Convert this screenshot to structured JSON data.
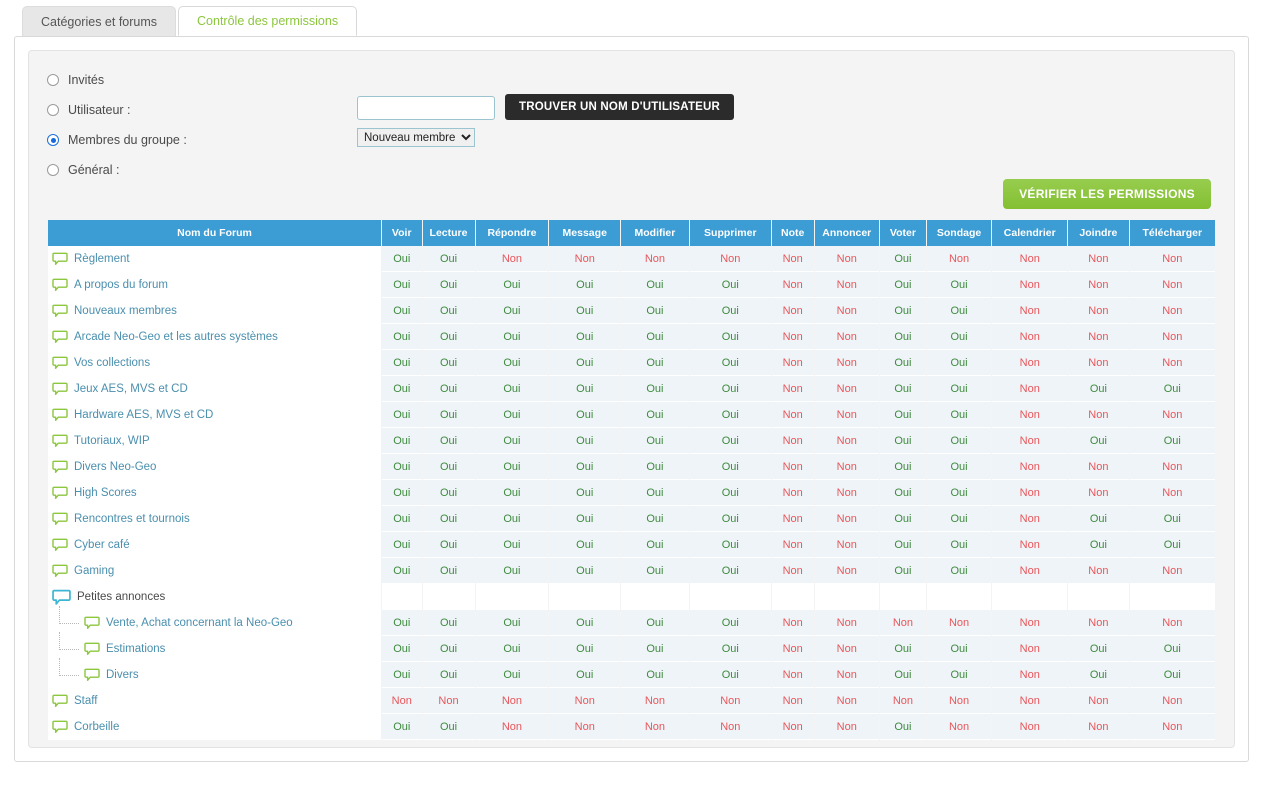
{
  "tabs": [
    {
      "label": "Catégories et forums",
      "active": false
    },
    {
      "label": "Contrôle des permissions",
      "active": true
    }
  ],
  "form": {
    "options": [
      {
        "label": "Invités",
        "checked": false
      },
      {
        "label": "Utilisateur :",
        "checked": false
      },
      {
        "label": "Membres du groupe :",
        "checked": true
      },
      {
        "label": "Général :",
        "checked": false
      }
    ],
    "username_value": "",
    "username_placeholder": "",
    "find_user_button": "TROUVER UN NOM D'UTILISATEUR",
    "group_selected": "Nouveau membre",
    "group_options": [
      "Nouveau membre"
    ],
    "verify_button": "VÉRIFIER LES PERMISSIONS"
  },
  "colors": {
    "header_blue": "#3c9cd4",
    "accent_green": "#8dc63f",
    "yes": "#3f8a3f",
    "no": "#e8565b",
    "link": "#4a8fae"
  },
  "table": {
    "columns": [
      "Nom du Forum",
      "Voir",
      "Lecture",
      "Répondre",
      "Message",
      "Modifier",
      "Supprimer",
      "Note",
      "Annoncer",
      "Voter",
      "Sondage",
      "Calendrier",
      "Joindre",
      "Télécharger"
    ],
    "rows": [
      {
        "name": "Règlement",
        "icon": "forum-bubble-icon",
        "type": "forum",
        "indent": 0,
        "values": [
          "Oui",
          "Oui",
          "Non",
          "Non",
          "Non",
          "Non",
          "Non",
          "Non",
          "Oui",
          "Non",
          "Non",
          "Non",
          "Non"
        ]
      },
      {
        "name": "A propos du forum",
        "icon": "forum-bubble-icon",
        "type": "forum",
        "indent": 0,
        "values": [
          "Oui",
          "Oui",
          "Oui",
          "Oui",
          "Oui",
          "Oui",
          "Non",
          "Non",
          "Oui",
          "Oui",
          "Non",
          "Non",
          "Non"
        ]
      },
      {
        "name": "Nouveaux membres",
        "icon": "forum-bubble-icon",
        "type": "forum",
        "indent": 0,
        "values": [
          "Oui",
          "Oui",
          "Oui",
          "Oui",
          "Oui",
          "Oui",
          "Non",
          "Non",
          "Oui",
          "Oui",
          "Non",
          "Non",
          "Non"
        ]
      },
      {
        "name": "Arcade Neo-Geo et les autres systèmes",
        "icon": "forum-bubble-icon",
        "type": "forum",
        "indent": 0,
        "values": [
          "Oui",
          "Oui",
          "Oui",
          "Oui",
          "Oui",
          "Oui",
          "Non",
          "Non",
          "Oui",
          "Oui",
          "Non",
          "Non",
          "Non"
        ]
      },
      {
        "name": "Vos collections",
        "icon": "forum-bubble-icon",
        "type": "forum",
        "indent": 0,
        "values": [
          "Oui",
          "Oui",
          "Oui",
          "Oui",
          "Oui",
          "Oui",
          "Non",
          "Non",
          "Oui",
          "Oui",
          "Non",
          "Non",
          "Non"
        ]
      },
      {
        "name": "Jeux AES, MVS et CD",
        "icon": "forum-bubble-icon",
        "type": "forum",
        "indent": 0,
        "values": [
          "Oui",
          "Oui",
          "Oui",
          "Oui",
          "Oui",
          "Oui",
          "Non",
          "Non",
          "Oui",
          "Oui",
          "Non",
          "Oui",
          "Oui"
        ]
      },
      {
        "name": "Hardware AES, MVS et CD",
        "icon": "forum-bubble-icon",
        "type": "forum",
        "indent": 0,
        "values": [
          "Oui",
          "Oui",
          "Oui",
          "Oui",
          "Oui",
          "Oui",
          "Non",
          "Non",
          "Oui",
          "Oui",
          "Non",
          "Non",
          "Non"
        ]
      },
      {
        "name": "Tutoriaux, WIP",
        "icon": "forum-bubble-icon",
        "type": "forum",
        "indent": 0,
        "values": [
          "Oui",
          "Oui",
          "Oui",
          "Oui",
          "Oui",
          "Oui",
          "Non",
          "Non",
          "Oui",
          "Oui",
          "Non",
          "Oui",
          "Oui"
        ]
      },
      {
        "name": "Divers Neo-Geo",
        "icon": "forum-bubble-icon",
        "type": "forum",
        "indent": 0,
        "values": [
          "Oui",
          "Oui",
          "Oui",
          "Oui",
          "Oui",
          "Oui",
          "Non",
          "Non",
          "Oui",
          "Oui",
          "Non",
          "Non",
          "Non"
        ]
      },
      {
        "name": "High Scores",
        "icon": "forum-bubble-icon",
        "type": "forum",
        "indent": 0,
        "values": [
          "Oui",
          "Oui",
          "Oui",
          "Oui",
          "Oui",
          "Oui",
          "Non",
          "Non",
          "Oui",
          "Oui",
          "Non",
          "Non",
          "Non"
        ]
      },
      {
        "name": "Rencontres et tournois",
        "icon": "forum-bubble-icon",
        "type": "forum",
        "indent": 0,
        "values": [
          "Oui",
          "Oui",
          "Oui",
          "Oui",
          "Oui",
          "Oui",
          "Non",
          "Non",
          "Oui",
          "Oui",
          "Non",
          "Oui",
          "Oui"
        ]
      },
      {
        "name": "Cyber café",
        "icon": "forum-bubble-icon",
        "type": "forum",
        "indent": 0,
        "values": [
          "Oui",
          "Oui",
          "Oui",
          "Oui",
          "Oui",
          "Oui",
          "Non",
          "Non",
          "Oui",
          "Oui",
          "Non",
          "Oui",
          "Oui"
        ]
      },
      {
        "name": "Gaming",
        "icon": "forum-bubble-icon",
        "type": "forum",
        "indent": 0,
        "values": [
          "Oui",
          "Oui",
          "Oui",
          "Oui",
          "Oui",
          "Oui",
          "Non",
          "Non",
          "Oui",
          "Oui",
          "Non",
          "Non",
          "Non"
        ]
      },
      {
        "name": "Petites annonces",
        "icon": "category-bubble-icon",
        "type": "category",
        "indent": 0,
        "values": [
          "",
          "",
          "",
          "",
          "",
          "",
          "",
          "",
          "",
          "",
          "",
          "",
          ""
        ]
      },
      {
        "name": "Vente, Achat concernant la Neo-Geo",
        "icon": "forum-bubble-icon",
        "type": "subforum",
        "indent": 1,
        "values": [
          "Oui",
          "Oui",
          "Oui",
          "Oui",
          "Oui",
          "Oui",
          "Non",
          "Non",
          "Non",
          "Non",
          "Non",
          "Non",
          "Non"
        ]
      },
      {
        "name": "Estimations",
        "icon": "forum-bubble-icon",
        "type": "subforum",
        "indent": 1,
        "values": [
          "Oui",
          "Oui",
          "Oui",
          "Oui",
          "Oui",
          "Oui",
          "Non",
          "Non",
          "Oui",
          "Oui",
          "Non",
          "Oui",
          "Oui"
        ]
      },
      {
        "name": "Divers",
        "icon": "forum-bubble-icon",
        "type": "subforum",
        "indent": 1,
        "values": [
          "Oui",
          "Oui",
          "Oui",
          "Oui",
          "Oui",
          "Oui",
          "Non",
          "Non",
          "Oui",
          "Oui",
          "Non",
          "Oui",
          "Oui"
        ]
      },
      {
        "name": "Staff",
        "icon": "forum-bubble-icon",
        "type": "forum",
        "indent": 0,
        "values": [
          "Non",
          "Non",
          "Non",
          "Non",
          "Non",
          "Non",
          "Non",
          "Non",
          "Non",
          "Non",
          "Non",
          "Non",
          "Non"
        ]
      },
      {
        "name": "Corbeille",
        "icon": "forum-bubble-icon",
        "type": "forum",
        "indent": 0,
        "values": [
          "Oui",
          "Oui",
          "Non",
          "Non",
          "Non",
          "Non",
          "Non",
          "Non",
          "Oui",
          "Non",
          "Non",
          "Non",
          "Non"
        ]
      }
    ]
  }
}
